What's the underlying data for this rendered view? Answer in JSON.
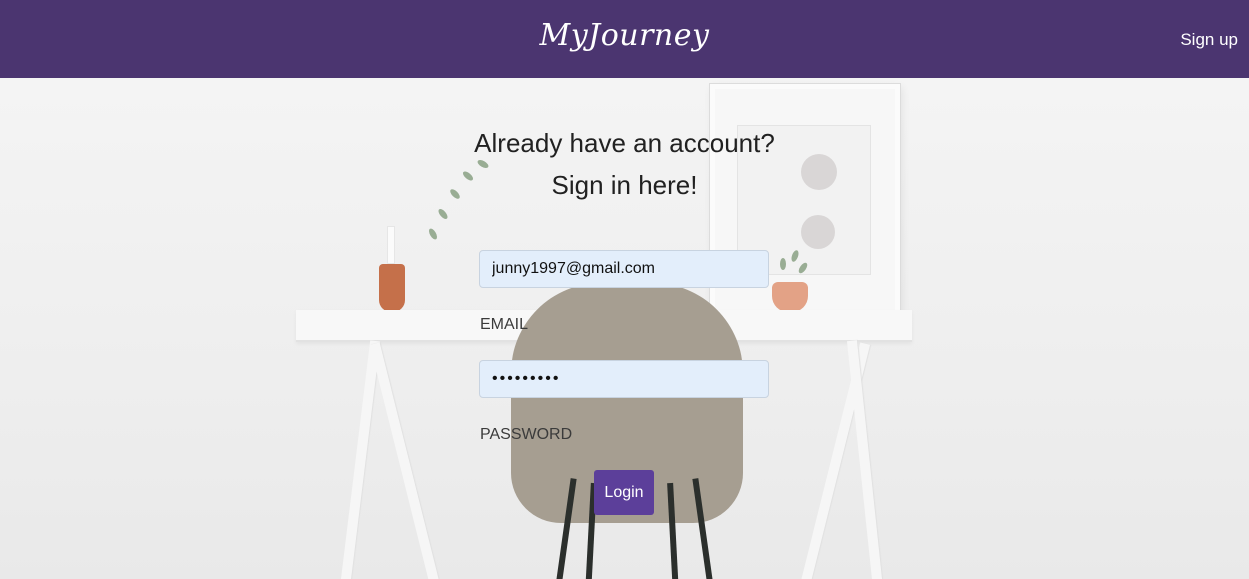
{
  "navbar": {
    "brand": "MyJourney",
    "signup_label": "Sign up"
  },
  "login": {
    "heading_line1": "Already have an account?",
    "heading_line2": "Sign in here!",
    "email_value": "junny1997@gmail.com",
    "email_label": "EMAIL",
    "password_value": "•••••••••",
    "password_label": "PASSWORD",
    "submit_label": "Login"
  },
  "colors": {
    "navbar": "#4b3570",
    "button": "#5c3f9a",
    "input_bg": "#e3eefb"
  }
}
